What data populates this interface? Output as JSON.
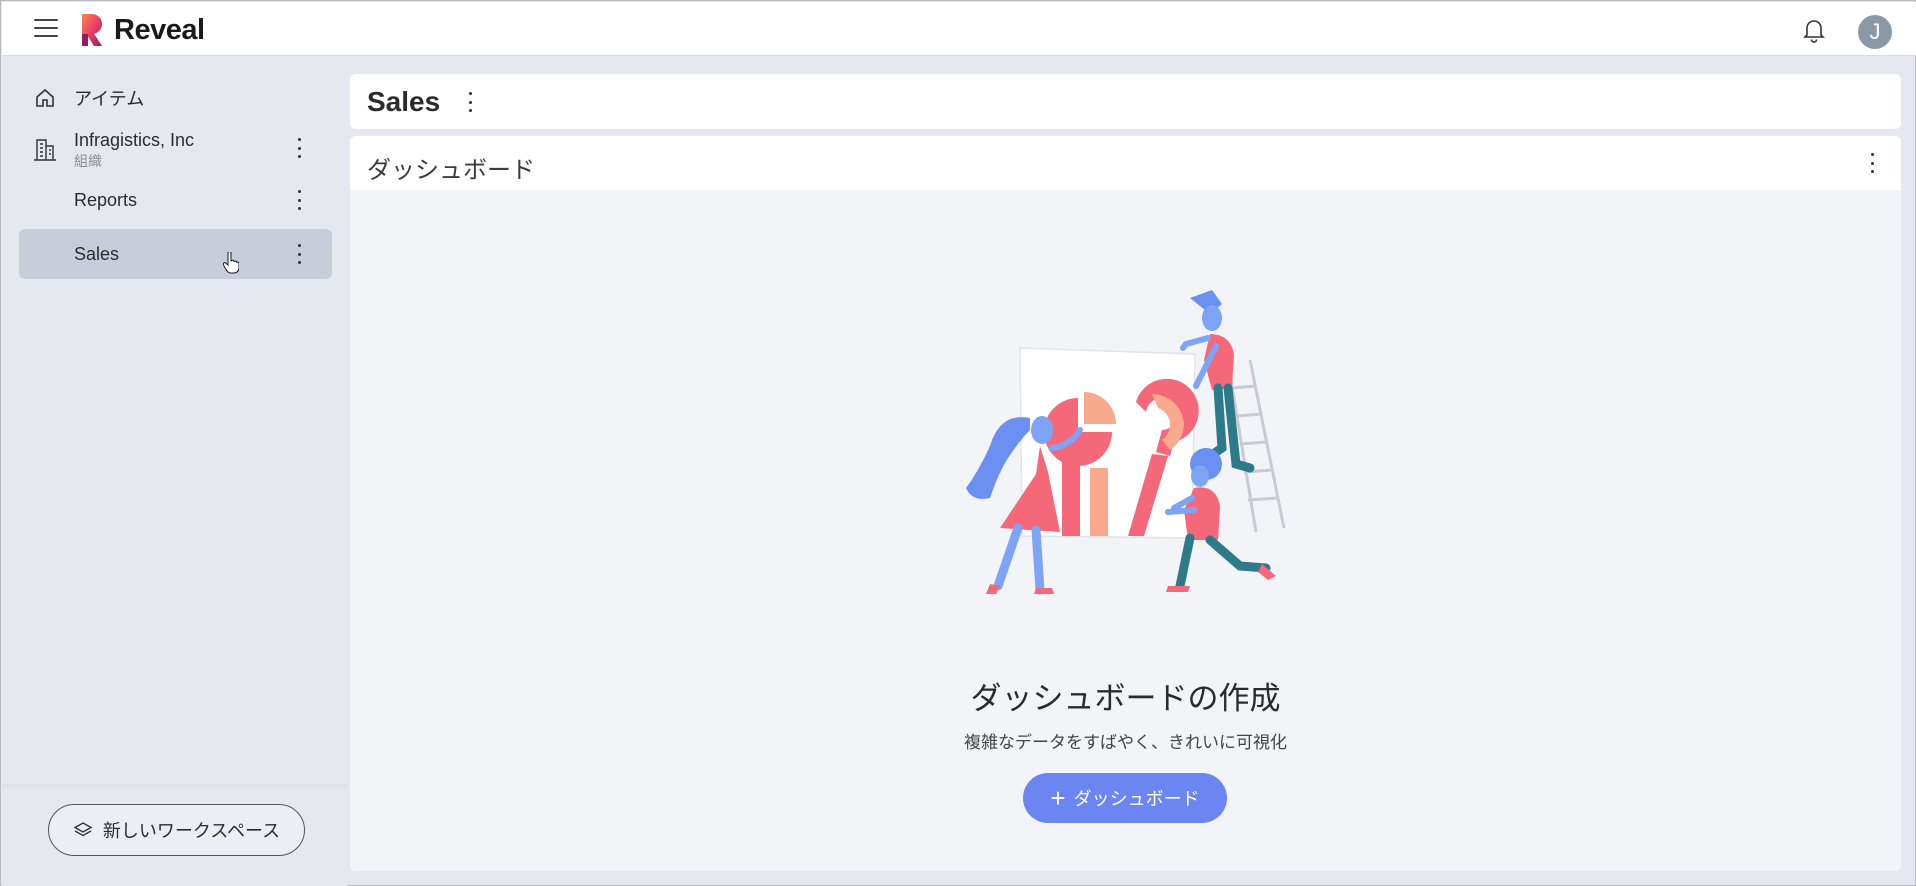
{
  "app": {
    "name": "Reveal",
    "avatar_initial": "J"
  },
  "sidebar": {
    "items": [
      {
        "label": "アイテム"
      },
      {
        "label": "Infragistics, Inc",
        "sub": "組織"
      },
      {
        "label": "Reports"
      },
      {
        "label": "Sales",
        "active": true
      }
    ],
    "new_workspace_label": "新しいワークスペース"
  },
  "main": {
    "title": "Sales",
    "section_title": "ダッシュボード",
    "empty_state": {
      "title": "ダッシュボードの作成",
      "subtitle": "複雑なデータをすばやく、きれいに可視化",
      "button_label": "ダッシュボード"
    }
  },
  "colors": {
    "accent": "#6b86f0",
    "active_item": "#c8cddc",
    "illustration_pink": "#f4687a",
    "illustration_peach": "#f9a98d",
    "illustration_blue": "#6c8ff2"
  },
  "icons": [
    "menu-icon",
    "reveal-logo",
    "bell-icon",
    "home-icon",
    "building-icon",
    "kebab-icon",
    "layers-icon",
    "plus-icon",
    "pointer-cursor-icon"
  ]
}
